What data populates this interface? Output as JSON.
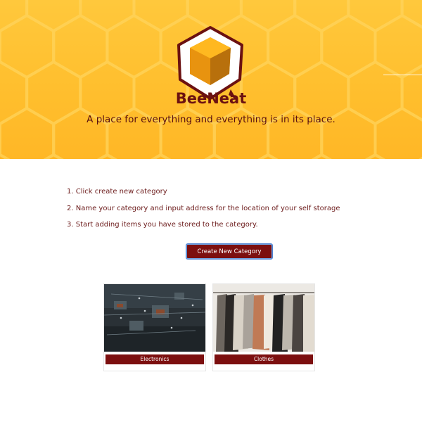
{
  "hero": {
    "brand": "BeeNeat",
    "tagline": "A place for everything and everything is in its place."
  },
  "steps": [
    "1. Click create new category",
    "2. Name your category and input address for the location of your self storage",
    "3. Start adding items you have stored to the category."
  ],
  "actions": {
    "create_label": "Create New Category"
  },
  "categories": [
    {
      "label": "Electronics",
      "image": "circuit-board-photo"
    },
    {
      "label": "Clothes",
      "image": "clothing-rack-photo"
    }
  ],
  "colors": {
    "hero": "#ffbf2e",
    "brand": "#6b1111",
    "button": "#7c0f0f",
    "text": "#6b1a1a"
  }
}
